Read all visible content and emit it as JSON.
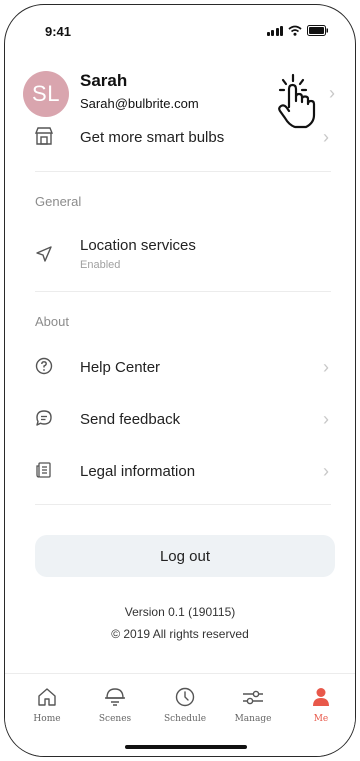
{
  "status_bar": {
    "time": "9:41"
  },
  "profile": {
    "initials": "SL",
    "name": "Sarah",
    "email": "Sarah@bulbrite.com",
    "avatar_color": "#d9a5ae"
  },
  "rows": {
    "smart_bulbs": {
      "label": "Get more smart bulbs",
      "icon": "store-icon"
    },
    "location": {
      "label": "Location services",
      "sublabel": "Enabled",
      "icon": "location-arrow-icon"
    },
    "help": {
      "label": "Help Center",
      "icon": "question-circle-icon"
    },
    "feedback": {
      "label": "Send feedback",
      "icon": "chat-bubble-icon"
    },
    "legal": {
      "label": "Legal information",
      "icon": "document-icon"
    }
  },
  "sections": {
    "general": "General",
    "about": "About"
  },
  "logout_label": "Log out",
  "version": {
    "line1": "Version 0.1 (190115)",
    "line2": "© 2019 All rights reserved"
  },
  "tabs": [
    {
      "label": "Home",
      "icon": "home-icon"
    },
    {
      "label": "Scenes",
      "icon": "bulb-icon"
    },
    {
      "label": "Schedule",
      "icon": "clock-icon"
    },
    {
      "label": "Manage",
      "icon": "sliders-icon"
    },
    {
      "label": "Me",
      "icon": "person-icon",
      "active": true
    }
  ],
  "colors": {
    "accent": "#e8584a",
    "logout_bg": "#eef2f5",
    "chevron": "#c8c8c8"
  }
}
